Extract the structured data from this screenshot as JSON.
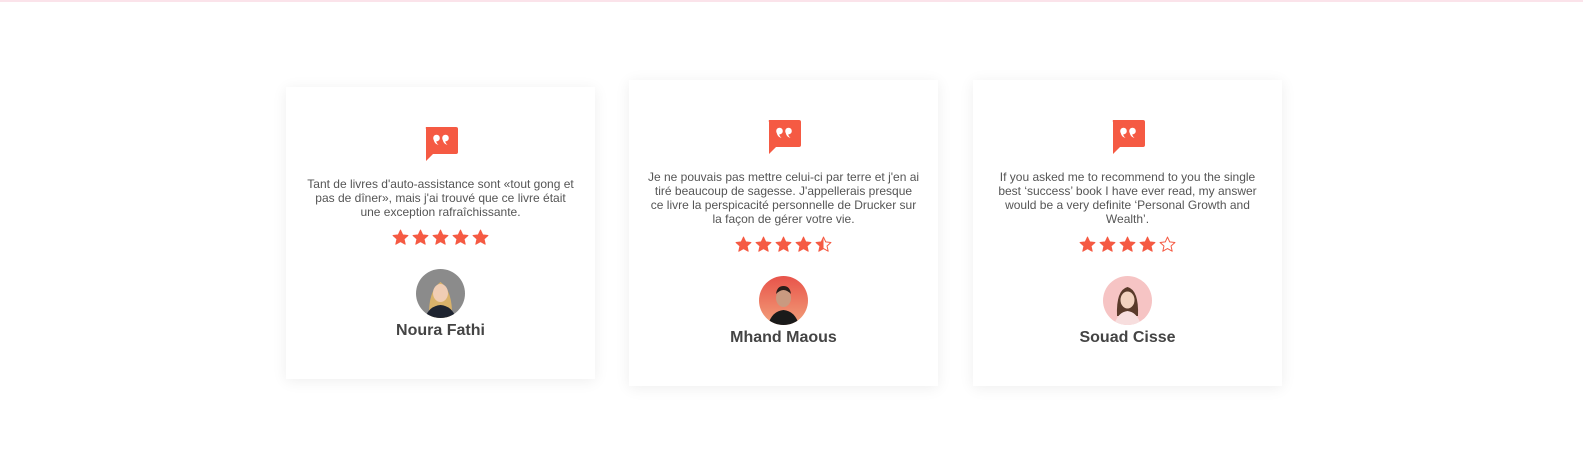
{
  "colors": {
    "accent": "#f55a43",
    "text": "#555555",
    "name": "#444444"
  },
  "testimonials": [
    {
      "quote": "Tant de livres d'auto-assistance sont «tout gong et pas de dîner», mais j'ai trouvé que ce livre était une exception rafraîchissante.",
      "rating": 5,
      "name": "Noura Fathi"
    },
    {
      "quote": "Je ne pouvais pas mettre celui-ci par terre et j'en ai tiré beaucoup de sagesse. J'appellerais presque ce livre la perspicacité personnelle de Drucker sur la façon de gérer votre vie.",
      "rating": 4.5,
      "name": "Mhand Maous"
    },
    {
      "quote": "If you asked me to recommend to you the single best ‘success’ book I have ever read, my answer would be a very definite ‘Personal Growth and Wealth’.",
      "rating": 4,
      "name": "Souad Cisse"
    }
  ]
}
